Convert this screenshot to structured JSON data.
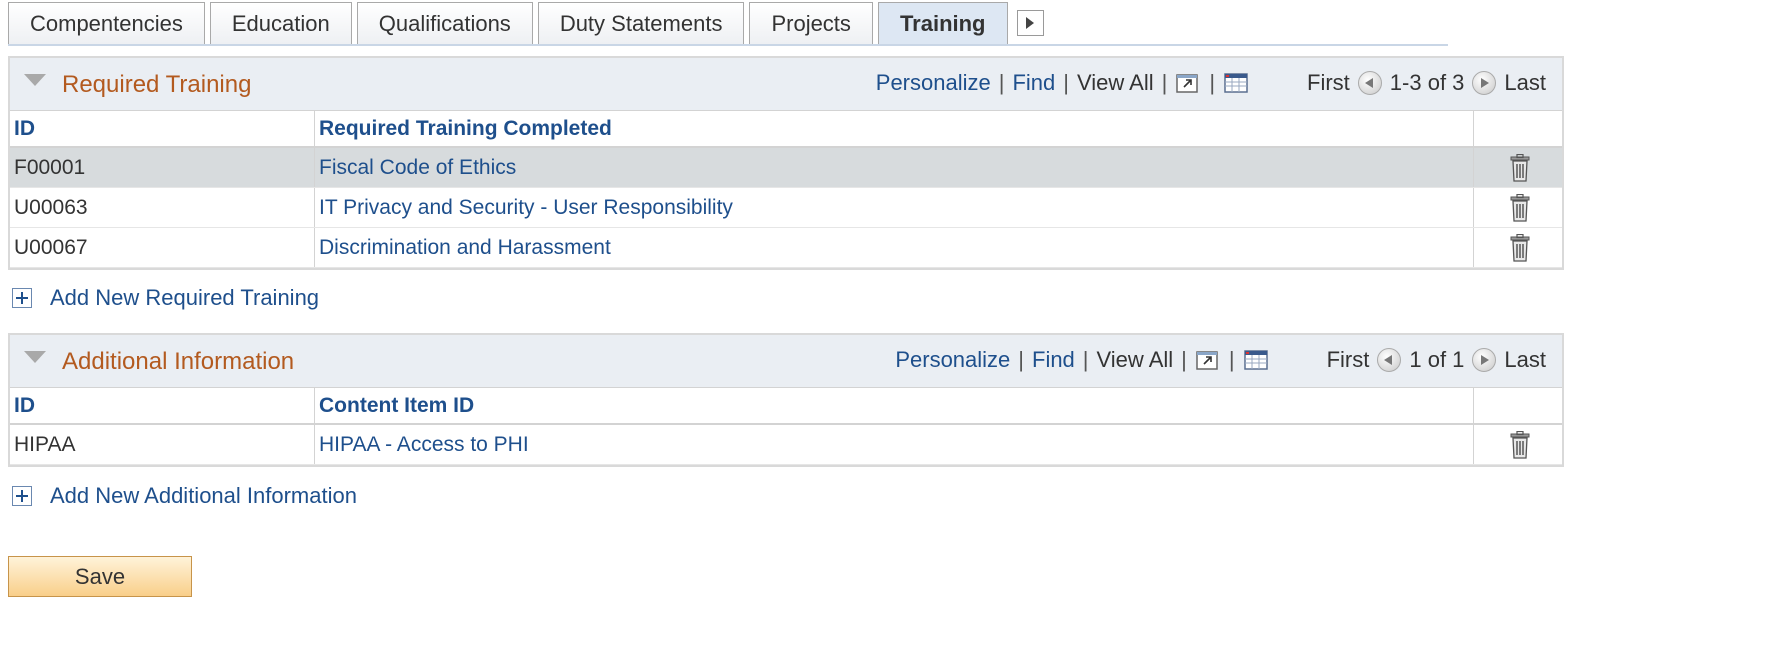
{
  "tabs": [
    {
      "label": "Compentencies",
      "active": false
    },
    {
      "label": "Education",
      "active": false
    },
    {
      "label": "Qualifications",
      "active": false
    },
    {
      "label": "Duty Statements",
      "active": false
    },
    {
      "label": "Projects",
      "active": false
    },
    {
      "label": "Training",
      "active": true
    }
  ],
  "required_training": {
    "title": "Required Training",
    "nav": {
      "personalize": "Personalize",
      "find": "Find",
      "view_all": "View All",
      "first": "First",
      "range": "1-3 of 3",
      "last": "Last"
    },
    "columns": [
      "ID",
      "Required Training Completed"
    ],
    "rows": [
      {
        "id": "F00001",
        "name": "Fiscal Code of Ethics"
      },
      {
        "id": "U00063",
        "name": "IT Privacy and Security - User Responsibility"
      },
      {
        "id": "U00067",
        "name": "Discrimination and Harassment"
      }
    ],
    "add_label": "Add New Required Training"
  },
  "additional_information": {
    "title": "Additional Information",
    "nav": {
      "personalize": "Personalize",
      "find": "Find",
      "view_all": "View All",
      "first": "First",
      "range": "1 of 1",
      "last": "Last"
    },
    "columns": [
      "ID",
      "Content Item ID"
    ],
    "rows": [
      {
        "id": "HIPAA",
        "name": "HIPAA - Access to PHI"
      }
    ],
    "add_label": "Add New Additional Information"
  },
  "save_label": "Save",
  "colors": {
    "accent_title": "#b35a1f",
    "link": "#1e4f8c",
    "header_bg": "#eaeef3",
    "selected_row": "#d7dbdd"
  },
  "icons": [
    "tab-scroll-right-icon",
    "collapse-triangle-icon",
    "zoom-window-icon",
    "spreadsheet-icon",
    "prev-circle-icon",
    "next-circle-icon",
    "trash-icon",
    "plus-icon"
  ]
}
